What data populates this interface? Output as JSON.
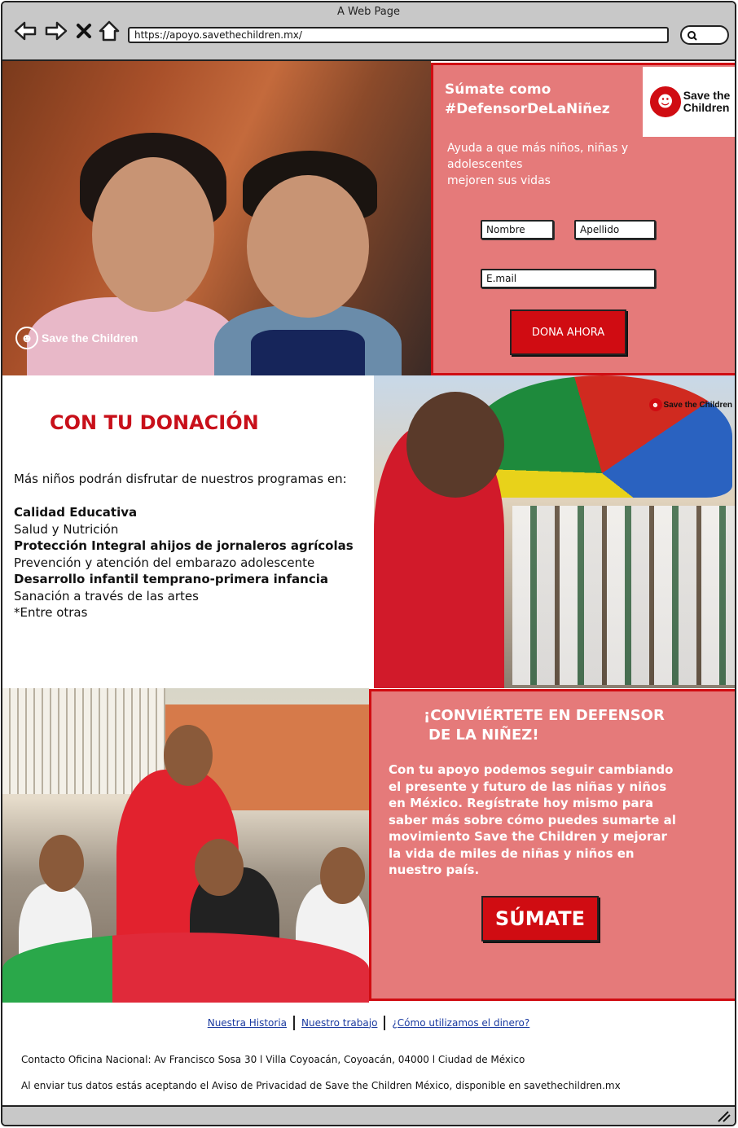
{
  "window": {
    "title": "A Web Page",
    "url": "https://apoyo.savethechildren.mx/"
  },
  "hero": {
    "photo_logo": "Save the Children",
    "heading_line1": "Súmate como",
    "heading_line2": "#DefensorDeLaNiñez",
    "brand_line1": "Save the",
    "brand_line2": "Children",
    "subtitle_line1": "Ayuda a que más niños, niñas y adolescentes",
    "subtitle_line2": "mejoren sus vidas",
    "form": {
      "first_name_placeholder": "Nombre",
      "last_name_placeholder": "Apellido",
      "email_placeholder": "E.mail",
      "submit_label": "DONA AHORA"
    }
  },
  "donation": {
    "title": "CON TU DONACIÓN",
    "intro": "Más niños podrán disfrutar de nuestros programas en:",
    "programs": [
      {
        "label": "Calidad Educativa"
      },
      {
        "label": "Salud y Nutrición"
      },
      {
        "label": "Protección Integral ahijos de jornaleros agrícolas"
      },
      {
        "label": "Prevención y atención del embarazo adolescente"
      },
      {
        "label": "Desarrollo infantil temprano-primera infancia"
      },
      {
        "label": "Sanación a través de las artes"
      },
      {
        "label": "*Entre otras"
      }
    ],
    "photo_logo": "Save the Children"
  },
  "cta": {
    "title_line1": "¡CONVIÉRTETE EN DEFENSOR",
    "title_line2": "DE LA NIÑEZ!",
    "body": "Con tu apoyo podemos seguir cambiando el presente y futuro de las niñas y niños en México. Regístrate hoy mismo para saber más sobre cómo puedes sumarte al movimiento Save the Children y mejorar la vida de miles de niñas y niños en nuestro país.",
    "button_label": "SÚMATE"
  },
  "footer": {
    "links": [
      "Nuestra Historia",
      "Nuestro trabajo",
      "¿Cómo utilizamos el dinero?"
    ],
    "contact": "Contacto Oficina Nacional: Av Francisco Sosa 30 l Villa Coyoacán, Coyoacán, 04000 l Ciudad de México",
    "privacy": "Al enviar tus datos estás aceptando el Aviso de Privacidad de Save the Children México, disponible en savethechildren.mx"
  },
  "colors": {
    "brand_red": "#d00c12",
    "panel_pink": "#e57a7a",
    "link_blue": "#1a3aa0"
  },
  "icons": [
    "back-arrow-icon",
    "forward-arrow-icon",
    "close-icon",
    "home-icon",
    "search-icon",
    "resize-grip-icon",
    "save-the-children-logo-icon"
  ]
}
